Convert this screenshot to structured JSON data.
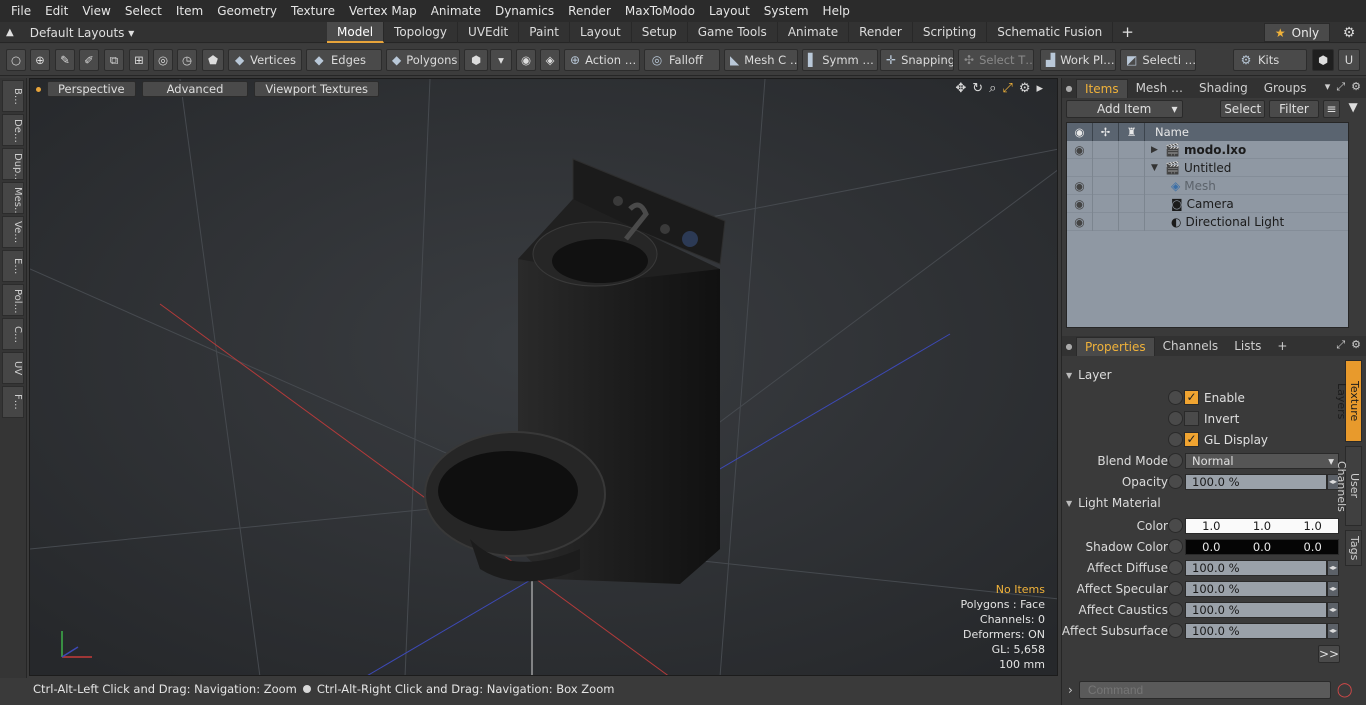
{
  "menu": [
    "File",
    "Edit",
    "View",
    "Select",
    "Item",
    "Geometry",
    "Texture",
    "Vertex Map",
    "Animate",
    "Dynamics",
    "Render",
    "MaxToModo",
    "Layout",
    "System",
    "Help"
  ],
  "layouts": {
    "label": "Default Layouts ▾"
  },
  "tabs": [
    "Model",
    "Topology",
    "UVEdit",
    "Paint",
    "Layout",
    "Setup",
    "Game Tools",
    "Animate",
    "Render",
    "Scripting",
    "Schematic Fusion"
  ],
  "only_label": "Only",
  "toolbar": {
    "vertices": "Vertices",
    "edges": "Edges",
    "polygons": "Polygons",
    "action": "Action …",
    "falloff": "Falloff",
    "meshc": "Mesh C …",
    "symm": "Symm …",
    "snapping": "Snapping",
    "selectt": "Select T…",
    "workpl": "Work Pl…",
    "selecti": "Selecti …",
    "kits": "Kits"
  },
  "lefttabs": [
    "B…",
    "De…",
    "Dup…",
    "Mes…",
    "Ve…",
    "E…",
    "Pol…",
    "C…",
    "UV",
    "F…"
  ],
  "viewport": {
    "perspective": "Perspective",
    "advanced": "Advanced",
    "textures": "Viewport Textures"
  },
  "info": {
    "noitems": "No Items",
    "polygons": "Polygons : Face",
    "channels": "Channels: 0",
    "deformers": "Deformers: ON",
    "gl": "GL: 5,658",
    "unit": "100 mm"
  },
  "status": {
    "left": "Ctrl-Alt-Left Click and Drag: Navigation: Zoom",
    "right": "Ctrl-Alt-Right Click and Drag: Navigation: Box Zoom"
  },
  "panel": {
    "tabs": [
      "Items",
      "Mesh …",
      "Shading",
      "Groups"
    ],
    "add_item": "Add Item",
    "select": "Select",
    "filter": "Filter",
    "name_col": "Name",
    "items": [
      {
        "name": "modo.lxo"
      },
      {
        "name": "Untitled"
      },
      {
        "name": "Mesh"
      },
      {
        "name": "Camera"
      },
      {
        "name": "Directional Light"
      }
    ]
  },
  "props": {
    "tabs": [
      "Properties",
      "Channels",
      "Lists"
    ],
    "layer": "Layer",
    "enable": "Enable",
    "invert": "Invert",
    "gldisplay": "GL Display",
    "blend_label": "Blend Mode",
    "blend_value": "Normal",
    "opacity_label": "Opacity",
    "opacity_value": "100.0 %",
    "lightmat": "Light Material",
    "color_label": "Color",
    "color_r": "1.0",
    "color_g": "1.0",
    "color_b": "1.0",
    "shadow_label": "Shadow Color",
    "shadow_r": "0.0",
    "shadow_g": "0.0",
    "shadow_b": "0.0",
    "diffuse_label": "Affect Diffuse",
    "diffuse_value": "100.0 %",
    "specular_label": "Affect Specular",
    "specular_value": "100.0 %",
    "caustics_label": "Affect Caustics",
    "caustics_value": "100.0 %",
    "subsurface_label": "Affect Subsurface",
    "subsurface_value": "100.0 %",
    "more": ">>",
    "sidetabs": [
      "Texture Layers",
      "User Channels",
      "Tags"
    ]
  },
  "command": {
    "placeholder": "Command"
  }
}
